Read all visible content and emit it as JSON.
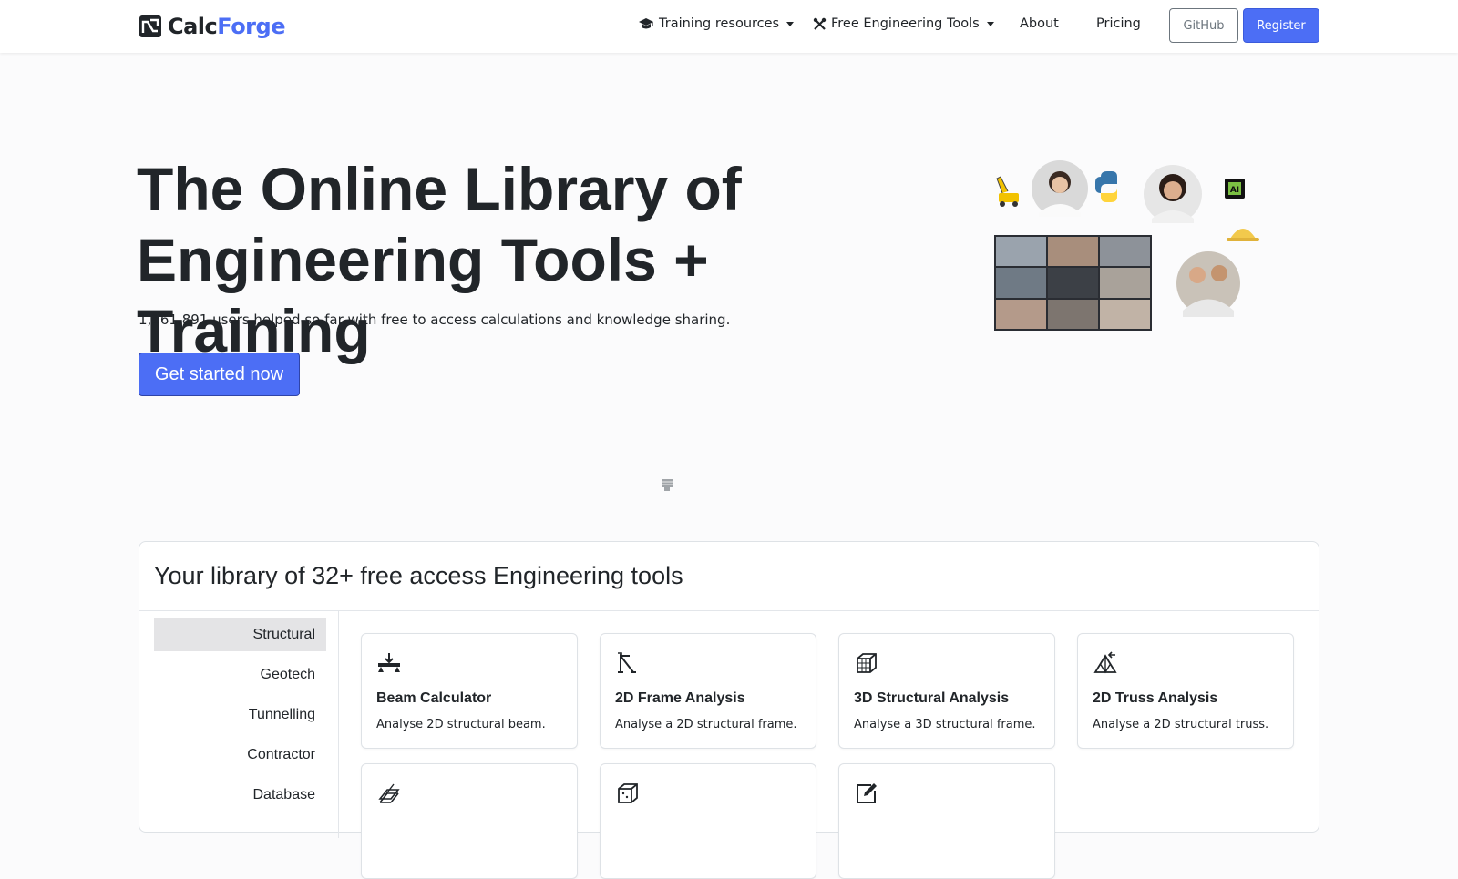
{
  "nav": {
    "brand_part1": "Calc",
    "brand_part2": "Forge",
    "training_label": "Training resources",
    "tools_label": "Free Engineering Tools",
    "about_label": "About",
    "pricing_label": "Pricing",
    "github_label": "GitHub",
    "register_label": "Register"
  },
  "hero": {
    "title_line1": "The Online Library of",
    "title_line2": "Engineering Tools + Training",
    "subtitle": "1,161,891 users helped so far with free to access calculations and knowledge sharing.",
    "cta_label": "Get started now"
  },
  "library": {
    "title": "Your library of 32+ free access Engineering tools",
    "categories": [
      "Structural",
      "Geotech",
      "Tunnelling",
      "Contractor",
      "Database"
    ],
    "active_category": "Structural",
    "tools": [
      {
        "name": "Beam Calculator",
        "desc": "Analyse 2D structural beam.",
        "icon": "beam-icon"
      },
      {
        "name": "2D Frame Analysis",
        "desc": "Analyse a 2D structural frame.",
        "icon": "frame-icon"
      },
      {
        "name": "3D Structural Analysis",
        "desc": "Analyse a 3D structural frame.",
        "icon": "cube-frame-icon"
      },
      {
        "name": "2D Truss Analysis",
        "desc": "Analyse a 2D structural truss.",
        "icon": "truss-icon"
      },
      {
        "name": "",
        "desc": "",
        "icon": "section-icon"
      },
      {
        "name": "",
        "desc": "",
        "icon": "cube-icon"
      },
      {
        "name": "",
        "desc": "",
        "icon": "edit-icon"
      }
    ]
  },
  "colors": {
    "primary": "#4c6ef5",
    "text": "#212529",
    "background": "#fbfbfc"
  }
}
